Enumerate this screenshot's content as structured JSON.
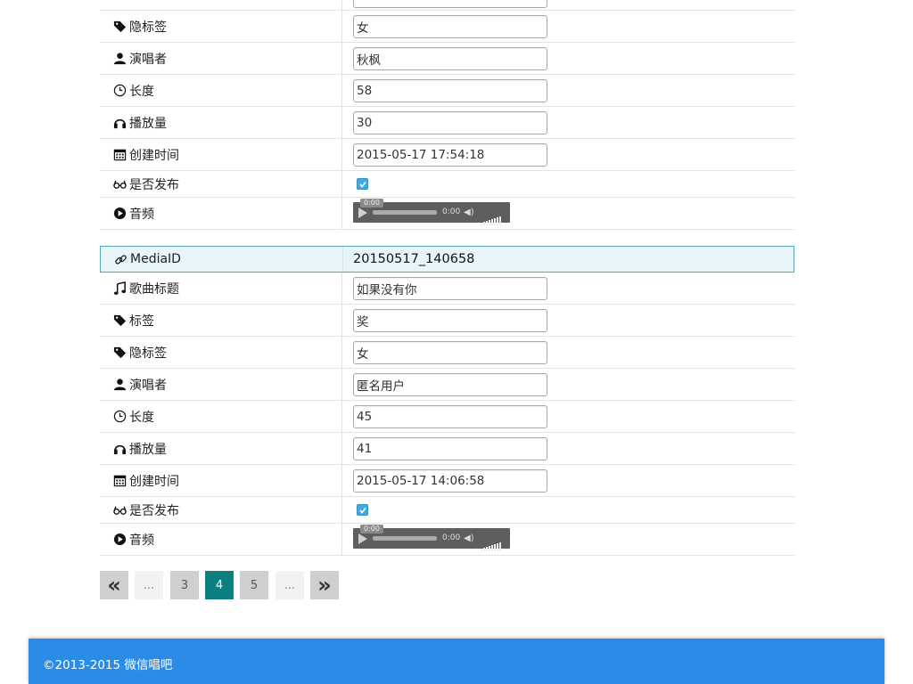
{
  "record1": {
    "hidden_tag": {
      "label": "隐标签",
      "value": "女"
    },
    "singer": {
      "label": "演唱者",
      "value": "秋枫"
    },
    "length": {
      "label": "长度",
      "value": "58"
    },
    "plays": {
      "label": "播放量",
      "value": "30"
    },
    "created": {
      "label": "创建时间",
      "value": "2015-05-17 17:54:18"
    },
    "published": {
      "label": "是否发布",
      "checked": true
    },
    "audio": {
      "label": "音频",
      "tip": "0:00",
      "time": "0:00"
    }
  },
  "record2": {
    "media_id": {
      "label": "MediaID",
      "value": "20150517_140658"
    },
    "title": {
      "label": "歌曲标题",
      "value": "如果没有你"
    },
    "tag": {
      "label": "标签",
      "value": "奖"
    },
    "hidden_tag": {
      "label": "隐标签",
      "value": "女"
    },
    "singer": {
      "label": "演唱者",
      "value": "匿名用户"
    },
    "length": {
      "label": "长度",
      "value": "45"
    },
    "plays": {
      "label": "播放量",
      "value": "41"
    },
    "created": {
      "label": "创建时间",
      "value": "2015-05-17 14:06:58"
    },
    "published": {
      "label": "是否发布",
      "checked": true
    },
    "audio": {
      "label": "音频",
      "tip": "0:00",
      "time": "0:00"
    }
  },
  "pagination": {
    "prev": "«",
    "ellipsis_left": "...",
    "pages": [
      "3",
      "4",
      "5"
    ],
    "current": "4",
    "ellipsis_right": "...",
    "next": "»"
  },
  "footer": {
    "text": "©2013-2015 微信唱吧"
  },
  "colors": {
    "accent": "#0c8080",
    "footer_bg": "#2b8ce8",
    "highlight_bg": "#e7f5fa"
  }
}
